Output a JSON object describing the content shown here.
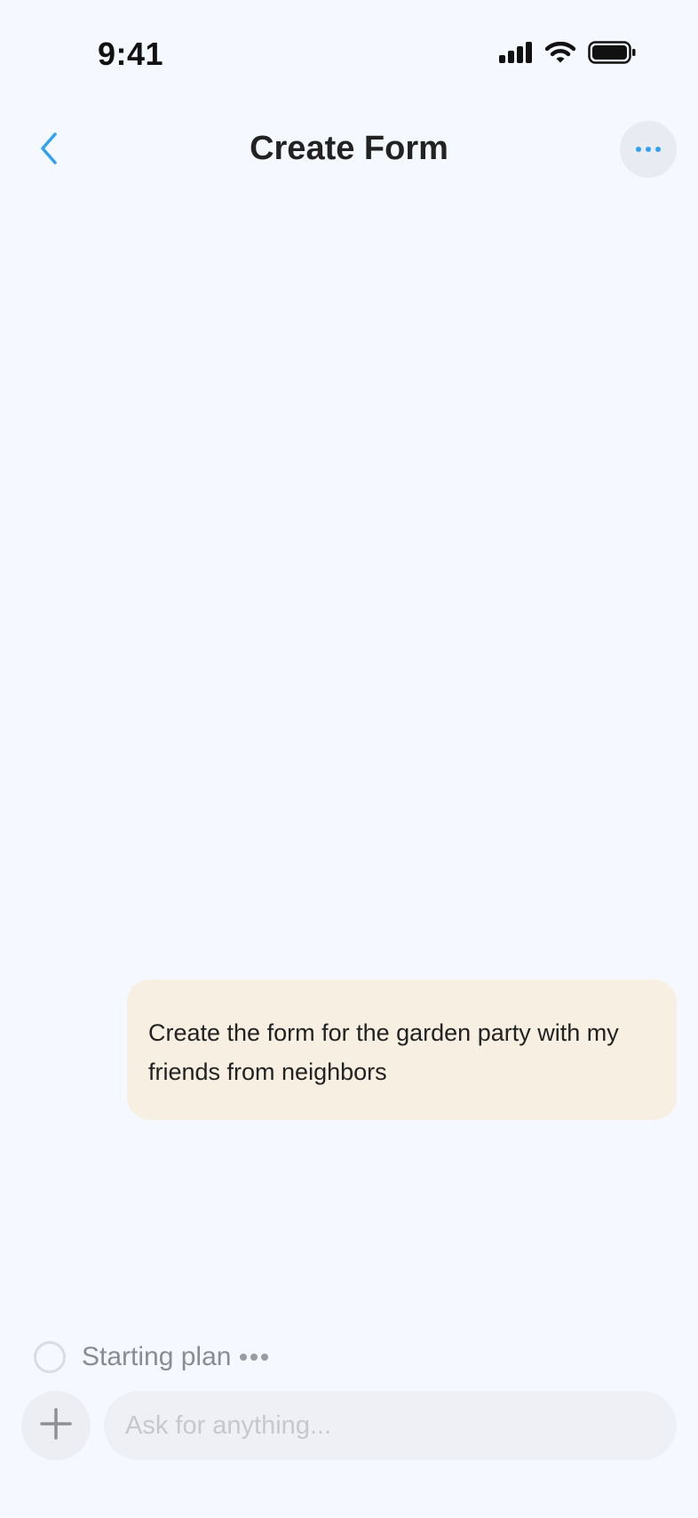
{
  "status_bar": {
    "time": "9:41",
    "icons": [
      "cellular-signal-icon",
      "wifi-icon",
      "battery-icon"
    ]
  },
  "header": {
    "title": "Create Form",
    "back_icon": "chevron-left-icon",
    "more_icon": "ellipsis-icon"
  },
  "conversation": {
    "messages": [
      {
        "role": "user",
        "text": "Create the form for the garden party with my friends from neighbors"
      }
    ]
  },
  "plan_status": {
    "label": "Starting plan"
  },
  "composer": {
    "placeholder": "Ask for anything...",
    "value": "",
    "add_icon": "plus-icon"
  },
  "colors": {
    "background": "#f5f8fe",
    "accent": "#2ea3f2",
    "user_bubble": "#f7efe1"
  }
}
